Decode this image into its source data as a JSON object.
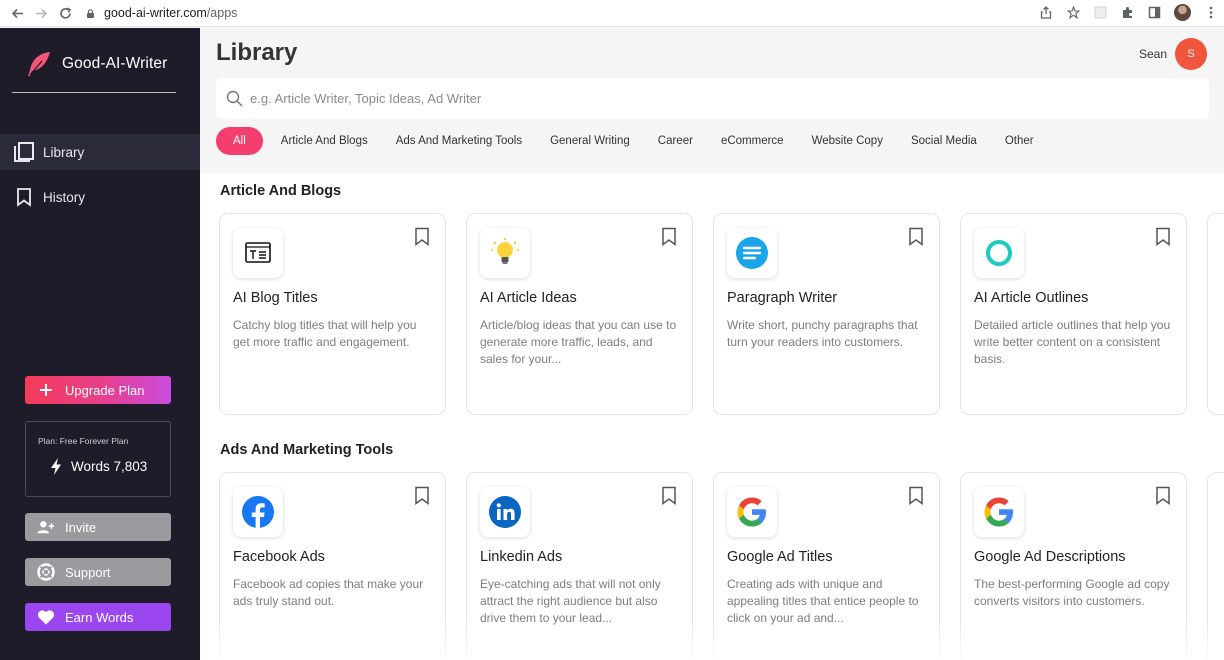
{
  "browser": {
    "url_host": "good-ai-writer.com",
    "url_path": "/apps"
  },
  "sidebar": {
    "brand": "Good-AI-Writer",
    "nav": [
      {
        "label": "Library",
        "icon": "library-icon"
      },
      {
        "label": "History",
        "icon": "bookmark-icon"
      }
    ],
    "upgrade_label": "Upgrade Plan",
    "plan_label": "Plan: Free Forever Plan",
    "words_label": "Words 7,803",
    "invite_label": "Invite",
    "support_label": "Support",
    "earn_label": "Earn Words"
  },
  "header": {
    "title": "Library",
    "user_name": "Sean",
    "avatar_initial": "S",
    "search_placeholder": "e.g. Article Writer, Topic Ideas, Ad Writer"
  },
  "filters": [
    "All",
    "Article And Blogs",
    "Ads And Marketing Tools",
    "General Writing",
    "Career",
    "eCommerce",
    "Website Copy",
    "Social Media",
    "Other"
  ],
  "sections": [
    {
      "title": "Article And Blogs",
      "cards": [
        {
          "title": "AI Blog Titles",
          "desc": "Catchy blog titles that will help you get more traffic and engagement.",
          "icon": "blog-title-icon"
        },
        {
          "title": "AI Article Ideas",
          "desc": "Article/blog ideas that you can use to generate more traffic, leads, and sales for your...",
          "icon": "lightbulb-icon"
        },
        {
          "title": "Paragraph Writer",
          "desc": "Write short, punchy paragraphs that turn your readers into customers.",
          "icon": "paragraph-icon"
        },
        {
          "title": "AI Article Outlines",
          "desc": "Detailed article outlines that help you write better content on a consistent basis.",
          "icon": "outline-ring-icon"
        }
      ]
    },
    {
      "title": "Ads And Marketing Tools",
      "cards": [
        {
          "title": "Facebook Ads",
          "desc": "Facebook ad copies that make your ads truly stand out.",
          "icon": "facebook-icon"
        },
        {
          "title": "Linkedin Ads",
          "desc": "Eye-catching ads that will not only attract the right audience but also drive them to your lead...",
          "icon": "linkedin-icon"
        },
        {
          "title": "Google Ad Titles",
          "desc": "Creating ads with unique and appealing titles that entice people to click on your ad and...",
          "icon": "google-icon"
        },
        {
          "title": "Google Ad Descriptions",
          "desc": "The best-performing Google ad copy converts visitors into customers.",
          "icon": "google-icon"
        }
      ]
    }
  ],
  "colors": {
    "sidebar_bg": "#1d1c28",
    "accent_pink": "#f43f6e",
    "earn_purple": "#9b47f0",
    "avatar": "#f0563e"
  }
}
